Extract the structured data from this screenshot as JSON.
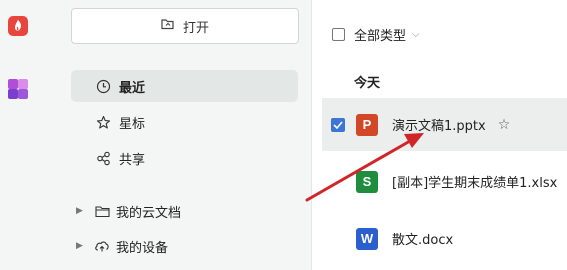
{
  "rail": {
    "logo_icon": "wps-logo-icon",
    "apps_icon": "apps-grid-icon"
  },
  "nav": {
    "open_button": {
      "label": "打开",
      "icon": "folder-open-icon"
    },
    "items": [
      {
        "label": "最近",
        "icon": "clock-icon",
        "active": true
      },
      {
        "label": "星标",
        "icon": "star-icon",
        "active": false
      },
      {
        "label": "共享",
        "icon": "share-icon",
        "active": false
      }
    ],
    "tree": [
      {
        "label": "我的云文档",
        "icon": "folder-icon"
      },
      {
        "label": "我的设备",
        "icon": "cloud-device-icon"
      }
    ]
  },
  "content": {
    "filter": {
      "label": "全部类型",
      "icon": "chevron-down-icon"
    },
    "section": "今天",
    "files": [
      {
        "name": "演示文稿1.pptx",
        "type_letter": "P",
        "color": "#d24726",
        "selected": true,
        "starred_icon": "star-icon"
      },
      {
        "name": "[副本]学生期末成绩单1.xlsx",
        "type_letter": "S",
        "color": "#1e8e3e",
        "selected": false
      },
      {
        "name": "散文.docx",
        "type_letter": "W",
        "color": "#2b5fce",
        "selected": false
      }
    ]
  },
  "colors": {
    "accent": "#3c74d8",
    "annotation_arrow": "#d0262a",
    "nav_bg": "#f4f5f5",
    "active_bg": "#e3e8e6"
  }
}
